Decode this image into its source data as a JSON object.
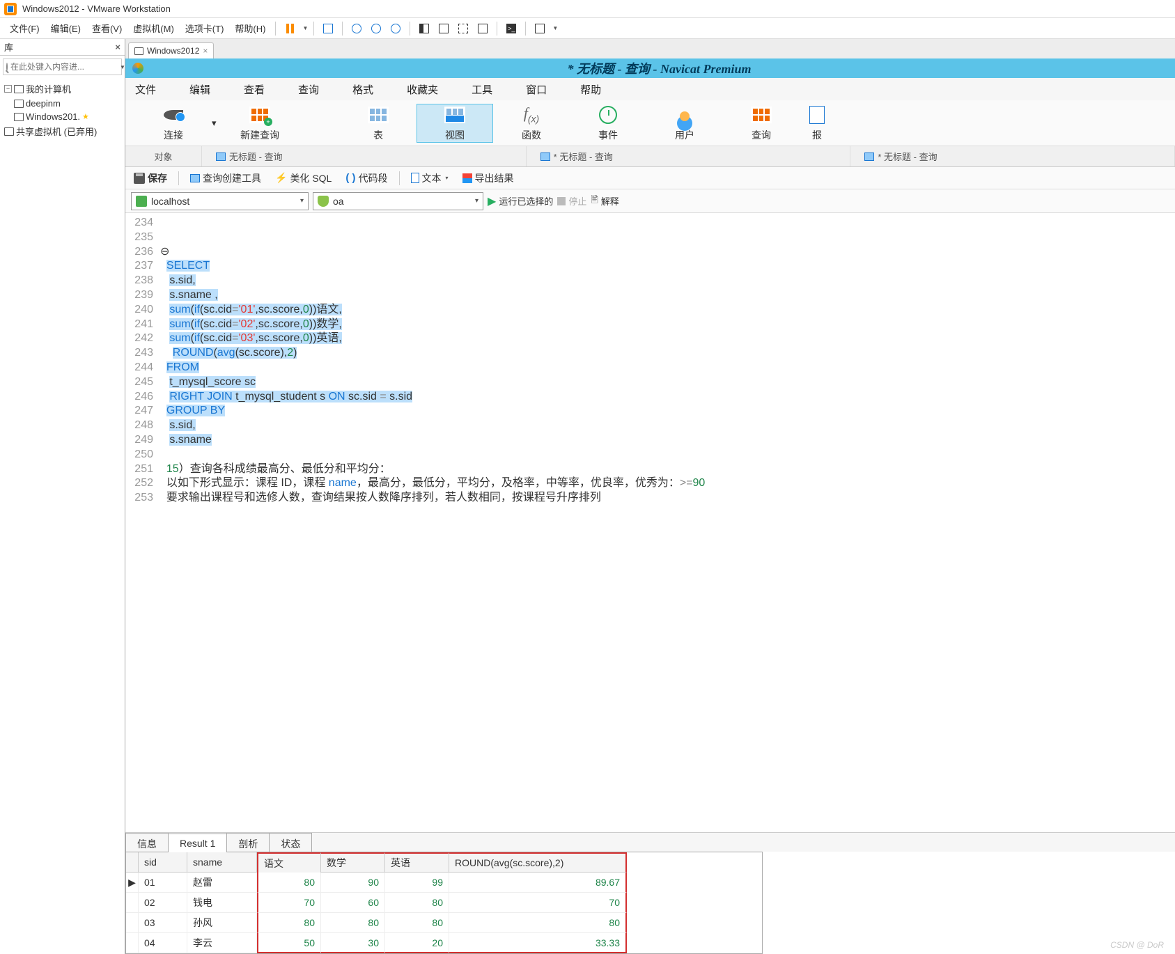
{
  "titlebar": {
    "title": "Windows2012 - VMware Workstation"
  },
  "menubar": {
    "items": [
      "文件(F)",
      "编辑(E)",
      "查看(V)",
      "虚拟机(M)",
      "选项卡(T)",
      "帮助(H)"
    ]
  },
  "sidebar": {
    "title": "库",
    "search_placeholder": "在此处键入内容进...",
    "nodes": {
      "root": "我的计算机",
      "children": [
        "deepinm",
        "Windows201."
      ],
      "shared": "共享虚拟机 (已弃用)"
    }
  },
  "vmtab": {
    "label": "Windows2012"
  },
  "navicat": {
    "title": "* 无标题 - 查询 - Navicat Premium",
    "menu": [
      "文件",
      "编辑",
      "查看",
      "查询",
      "格式",
      "收藏夹",
      "工具",
      "窗口",
      "帮助"
    ],
    "toolbar": [
      {
        "label": "连接"
      },
      {
        "label": "新建查询"
      },
      {
        "label": "表"
      },
      {
        "label": "视图"
      },
      {
        "label": "函数"
      },
      {
        "label": "事件"
      },
      {
        "label": "用户"
      },
      {
        "label": "查询"
      },
      {
        "label": "报"
      }
    ],
    "doctabs": [
      {
        "label": "对象"
      },
      {
        "label": "无标题 - 查询",
        "star": true
      },
      {
        "label": "* 无标题 - 查询",
        "star": true
      },
      {
        "label": "* 无标题 - 查询",
        "star": true
      }
    ],
    "sqlbar": {
      "save": "保存",
      "builder": "查询创建工具",
      "beautify": "美化 SQL",
      "snippet": "代码段",
      "text": "文本",
      "export": "导出结果"
    },
    "conn": {
      "host": "localhost",
      "db": "oa",
      "run": "运行已选择的",
      "stop": "停止",
      "explain": "解释"
    },
    "code": [
      {
        "n": 234,
        "t": ""
      },
      {
        "n": 235,
        "t": ""
      },
      {
        "n": 236,
        "t": "⊖"
      },
      {
        "n": 237,
        "t": "SELECT",
        "hl": true,
        "kw": true,
        "indent": "  "
      },
      {
        "n": 238,
        "t": "s.sid,",
        "hl": true,
        "indent": "   "
      },
      {
        "n": 239,
        "t": "s.sname ,",
        "hl": true,
        "indent": "   "
      },
      {
        "n": 240,
        "raw": true,
        "indent": "   "
      },
      {
        "n": 241,
        "raw": true,
        "indent": "   "
      },
      {
        "n": 242,
        "raw": true,
        "indent": "   "
      },
      {
        "n": 243,
        "raw": true,
        "indent": "    "
      },
      {
        "n": 244,
        "t": "FROM",
        "hl": true,
        "kw": true,
        "indent": "  "
      },
      {
        "n": 245,
        "t": "t_mysql_score sc",
        "hl": true,
        "indent": "   "
      },
      {
        "n": 246,
        "raw": true,
        "indent": "   "
      },
      {
        "n": 247,
        "t": "GROUP BY",
        "hl": true,
        "kw": true,
        "indent": "  "
      },
      {
        "n": 248,
        "t": "s.sid,",
        "hl": true,
        "indent": "   "
      },
      {
        "n": 249,
        "t": "s.sname",
        "hl": true,
        "indent": "   "
      },
      {
        "n": 250,
        "t": ""
      },
      {
        "n": 251,
        "t": "15）查询各科成绩最高分、最低分和平均分：",
        "indent": "  ",
        "pre15": true
      },
      {
        "n": 252,
        "t": "以如下形式显示：课程 ID，课程 name，最高分，最低分，平均分，及格率，中等率，优良率，优秀为：>=90",
        "indent": "  ",
        "has90": true
      },
      {
        "n": 253,
        "t": "要求输出课程号和选修人数，查询结果按人数降序排列，若人数相同，按课程号升序排列",
        "indent": "  "
      }
    ],
    "sum_lines": {
      "240": {
        "cid": "'01'",
        "han": "语文,"
      },
      "241": {
        "cid": "'02'",
        "han": "数学,"
      },
      "242": {
        "cid": "'03'",
        "han": "英语,"
      }
    },
    "restabs": [
      "信息",
      "Result 1",
      "剖析",
      "状态"
    ],
    "grid": {
      "cols": [
        "sid",
        "sname",
        "语文",
        "数学",
        "英语",
        "ROUND(avg(sc.score),2)"
      ],
      "rows": [
        {
          "ptr": true,
          "sid": "01",
          "sname": "赵雷",
          "c1": "80",
          "c2": "90",
          "c3": "99",
          "avg": "89.67"
        },
        {
          "sid": "02",
          "sname": "钱电",
          "c1": "70",
          "c2": "60",
          "c3": "80",
          "avg": "70"
        },
        {
          "sid": "03",
          "sname": "孙风",
          "c1": "80",
          "c2": "80",
          "c3": "80",
          "avg": "80"
        },
        {
          "sid": "04",
          "sname": "李云",
          "c1": "50",
          "c2": "30",
          "c3": "20",
          "avg": "33.33"
        }
      ]
    }
  },
  "watermark": "CSDN @ DoR"
}
